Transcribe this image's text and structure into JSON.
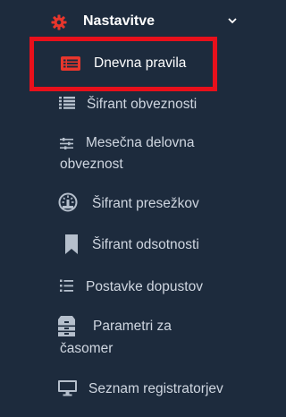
{
  "sidebar": {
    "section": {
      "label": "Nastavitve",
      "icon": "gear-icon",
      "expanded": true,
      "icon_color": "#e8362c"
    },
    "active_item": {
      "label": "Dnevna pravila",
      "icon": "list-card-icon",
      "highlight_color": "#e8101b"
    },
    "items": [
      {
        "label": "Šifrant obveznosti",
        "icon": "list-icon"
      },
      {
        "label_line1": "Mesečna delovna",
        "label_line2": "obveznost",
        "icon": "sliders-icon"
      },
      {
        "label": "Šifrant presežkov",
        "icon": "gauge-icon"
      },
      {
        "label": "Šifrant odsotnosti",
        "icon": "bookmark-icon"
      },
      {
        "label": "Postavke dopustov",
        "icon": "numbered-list-icon"
      },
      {
        "label_line1": "Parametri za",
        "label_line2": "časomer",
        "icon": "archive-icon"
      },
      {
        "label": "Seznam registratorjev",
        "icon": "monitor-icon"
      }
    ]
  }
}
